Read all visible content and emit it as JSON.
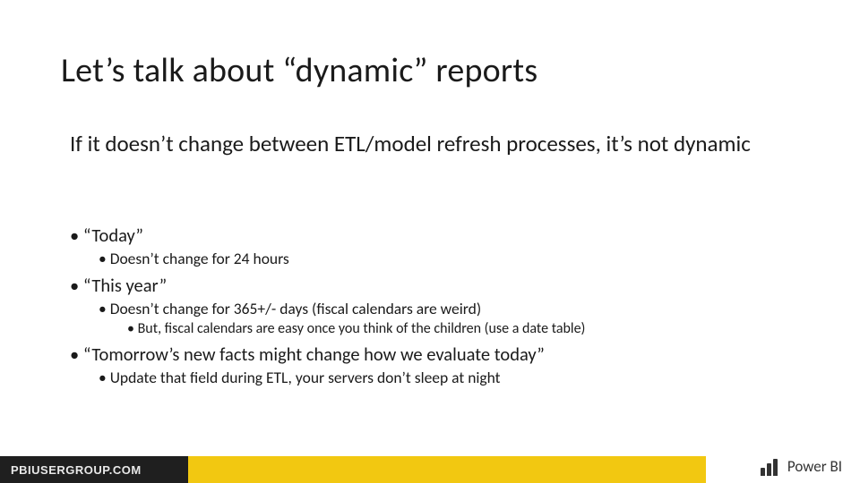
{
  "slide": {
    "title": "Let’s talk about “dynamic” reports",
    "subtitle": "If it doesn’t change between ETL/model refresh processes, it’s not dynamic",
    "bullets": [
      {
        "text": "“Today”",
        "children": [
          {
            "text": "Doesn’t change for 24 hours"
          }
        ]
      },
      {
        "text": "“This year”",
        "children": [
          {
            "text": "Doesn’t change for 365+/- days (fiscal calendars are weird)",
            "children": [
              {
                "text": "But, fiscal calendars are easy once you think of the children (use a date table)"
              }
            ]
          }
        ]
      },
      {
        "text": "“Tomorrow’s new facts might change how we evaluate today”",
        "children": [
          {
            "text": "Update that field during ETL, your servers don’t sleep at night"
          }
        ]
      }
    ]
  },
  "footer": {
    "left": "PBIUSERGROUP.COM",
    "brand": "Power BI"
  }
}
